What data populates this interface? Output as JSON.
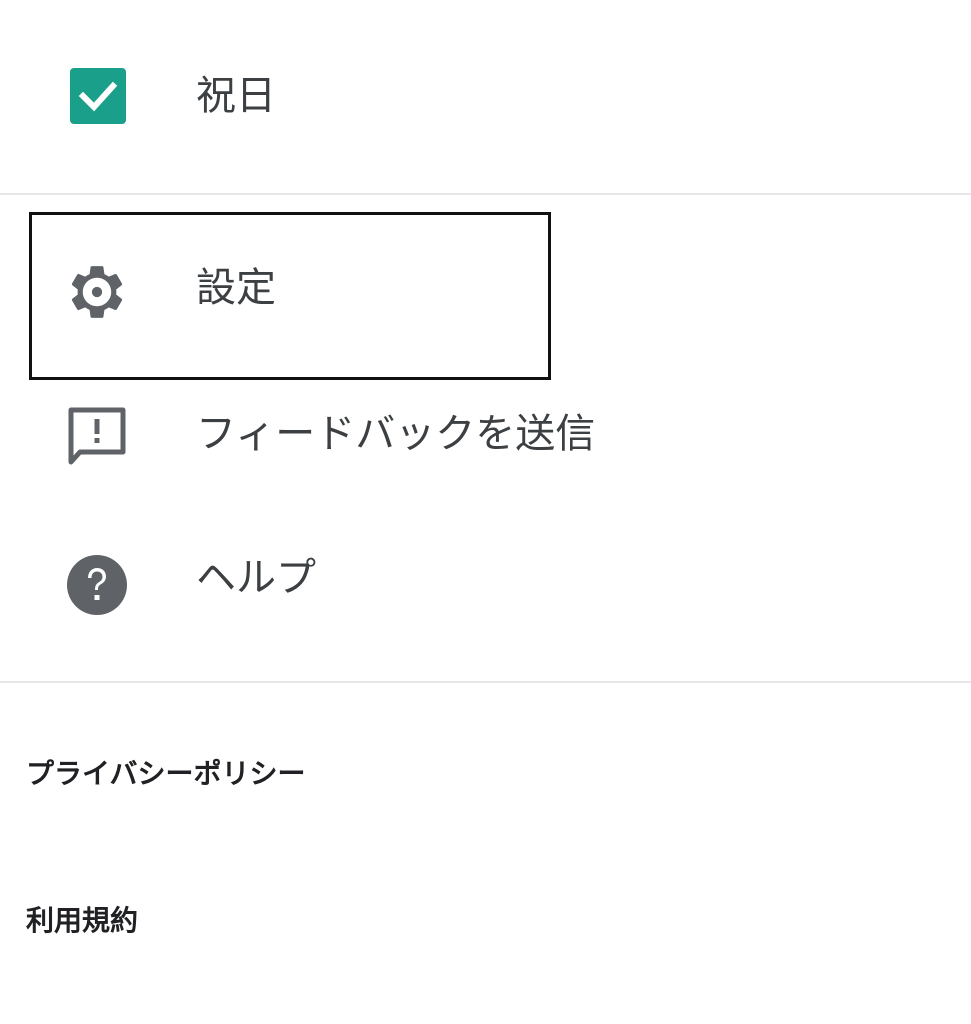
{
  "menu": {
    "holidays": {
      "label": "祝日",
      "checked": true,
      "icon": "checkbox-checked-icon",
      "color": "#1a9f8a"
    },
    "settings": {
      "label": "設定",
      "icon": "gear-icon"
    },
    "feedback": {
      "label": "フィードバックを送信",
      "icon": "feedback-icon"
    },
    "help": {
      "label": "ヘルプ",
      "icon": "help-icon"
    }
  },
  "footer": {
    "privacy": "プライバシーポリシー",
    "terms": "利用規約"
  }
}
